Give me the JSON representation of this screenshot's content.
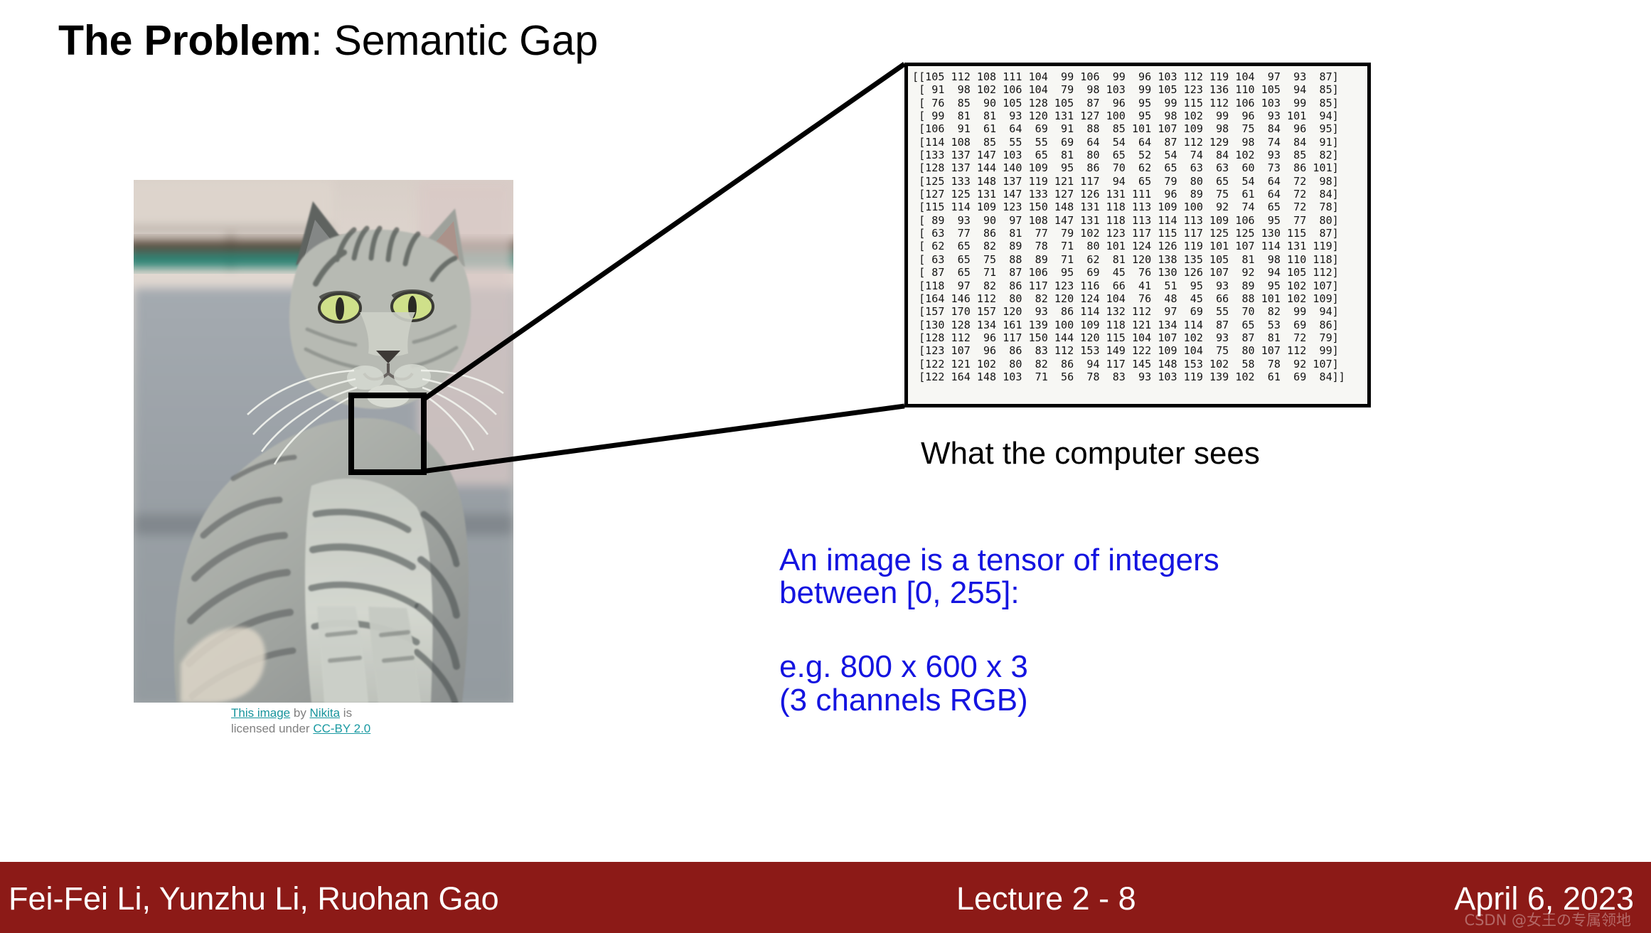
{
  "title": {
    "bold_part": "The Problem",
    "rest_part": ": Semantic Gap"
  },
  "figure": {
    "caption_line1_link1": "This image",
    "caption_line1_mid": " by ",
    "caption_line1_link2": "Nikita",
    "caption_line1_end": " is",
    "caption_line2_start": "licensed under ",
    "caption_line2_link": "CC-BY 2.0",
    "alt": "gray tabby cat sitting outdoors"
  },
  "matrix": {
    "caption": "What the computer sees",
    "rows": [
      "[[105 112 108 111 104  99 106  99  96 103 112 119 104  97  93  87]",
      " [ 91  98 102 106 104  79  98 103  99 105 123 136 110 105  94  85]",
      " [ 76  85  90 105 128 105  87  96  95  99 115 112 106 103  99  85]",
      " [ 99  81  81  93 120 131 127 100  95  98 102  99  96  93 101  94]",
      " [106  91  61  64  69  91  88  85 101 107 109  98  75  84  96  95]",
      " [114 108  85  55  55  69  64  54  64  87 112 129  98  74  84  91]",
      " [133 137 147 103  65  81  80  65  52  54  74  84 102  93  85  82]",
      " [128 137 144 140 109  95  86  70  62  65  63  63  60  73  86 101]",
      " [125 133 148 137 119 121 117  94  65  79  80  65  54  64  72  98]",
      " [127 125 131 147 133 127 126 131 111  96  89  75  61  64  72  84]",
      " [115 114 109 123 150 148 131 118 113 109 100  92  74  65  72  78]",
      " [ 89  93  90  97 108 147 131 118 113 114 113 109 106  95  77  80]",
      " [ 63  77  86  81  77  79 102 123 117 115 117 125 125 130 115  87]",
      " [ 62  65  82  89  78  71  80 101 124 126 119 101 107 114 131 119]",
      " [ 63  65  75  88  89  71  62  81 120 138 135 105  81  98 110 118]",
      " [ 87  65  71  87 106  95  69  45  76 130 126 107  92  94 105 112]",
      " [118  97  82  86 117 123 116  66  41  51  95  93  89  95 102 107]",
      " [164 146 112  80  82 120 124 104  76  48  45  66  88 101 102 109]",
      " [157 170 157 120  93  86 114 132 112  97  69  55  70  82  99  94]",
      " [130 128 134 161 139 100 109 118 121 134 114  87  65  53  69  86]",
      " [128 112  96 117 150 144 120 115 104 107 102  93  87  81  72  79]",
      " [123 107  96  86  83 112 153 149 122 109 104  75  80 107 112  99]",
      " [122 121 102  80  82  86  94 117 145 148 153 102  58  78  92 107]",
      " [122 164 148 103  71  56  78  83  93 103 119 139 102  61  69  84]]"
    ]
  },
  "notes": {
    "line1": "An image is a tensor of integers",
    "line2": "between [0, 255]:",
    "line3": "e.g. 800 x 600 x 3",
    "line4": "(3 channels RGB)"
  },
  "footer": {
    "authors": "Fei-Fei Li, Yunzhu Li, Ruohan Gao",
    "lecture": "Lecture 2 -   8",
    "date": "April 6, 2023",
    "watermark": "CSDN @女王の专属领地"
  },
  "colors": {
    "footer_bg": "#8c1a17",
    "note_text": "#1414e0",
    "link": "#17949c",
    "matrix_bg": "#f7f7f4"
  }
}
